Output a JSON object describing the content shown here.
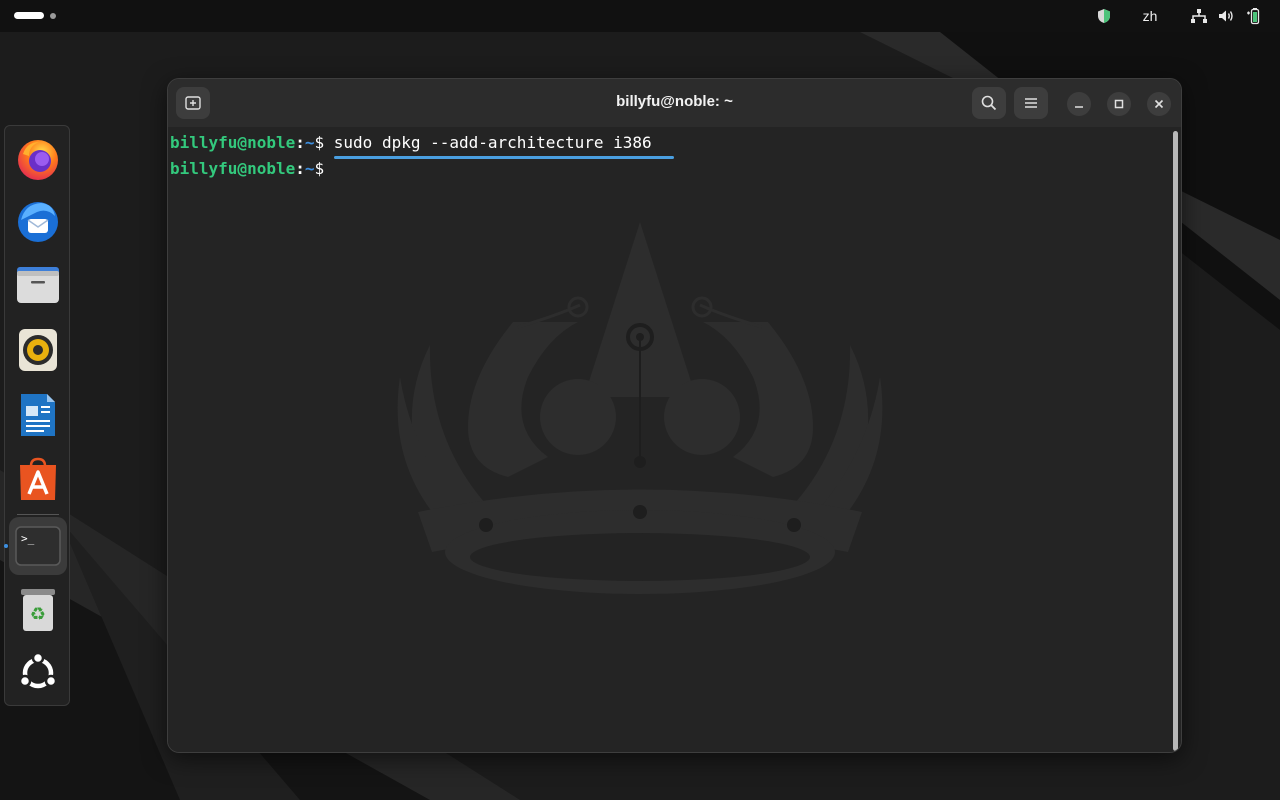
{
  "topbar": {
    "language": "zh",
    "icons": [
      "shield-icon",
      "network-icon",
      "volume-icon",
      "battery-icon"
    ]
  },
  "dock": {
    "apps": [
      {
        "name": "firefox",
        "icon": "firefox-icon"
      },
      {
        "name": "thunderbird",
        "icon": "thunderbird-icon"
      },
      {
        "name": "files",
        "icon": "files-icon"
      },
      {
        "name": "rhythmbox",
        "icon": "rhythmbox-icon"
      },
      {
        "name": "libreoffice-writer",
        "icon": "writer-icon"
      },
      {
        "name": "app-center",
        "icon": "app-center-icon"
      },
      {
        "name": "terminal",
        "icon": "terminal-icon",
        "running": true
      },
      {
        "name": "trash",
        "icon": "trash-icon"
      },
      {
        "name": "show-apps",
        "icon": "ubuntu-icon"
      }
    ]
  },
  "window": {
    "title": "billyfu@noble: ~",
    "lines": [
      {
        "user": "billyfu@noble",
        "colon": ":",
        "path": "~",
        "dollar": "$ ",
        "command": "sudo dpkg --add-architecture i386"
      },
      {
        "user": "billyfu@noble",
        "colon": ":",
        "path": "~",
        "dollar": "$ ",
        "command": ""
      }
    ]
  },
  "colors": {
    "prompt_user": "#33c97d",
    "prompt_path": "#3d8fe0",
    "highlight": "#4a9fe0",
    "terminal_bg": "#242424",
    "header_bg": "#2c2c2c"
  }
}
